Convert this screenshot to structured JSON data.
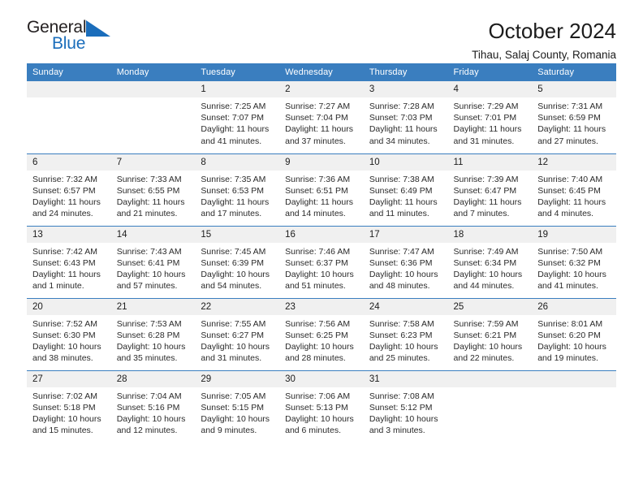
{
  "brand": {
    "name_part1": "General",
    "name_part2": "Blue",
    "accent_color": "#1a6dbb"
  },
  "header": {
    "title": "October 2024",
    "subtitle": "Tihau, Salaj County, Romania"
  },
  "calendar": {
    "header_bg": "#3a7ebf",
    "daynum_bg": "#f0f0f0",
    "weekday_headers": [
      "Sunday",
      "Monday",
      "Tuesday",
      "Wednesday",
      "Thursday",
      "Friday",
      "Saturday"
    ],
    "labels": {
      "sunrise": "Sunrise:",
      "sunset": "Sunset:",
      "daylight": "Daylight:"
    },
    "weeks": [
      [
        {
          "day": "",
          "empty": true
        },
        {
          "day": "",
          "empty": true
        },
        {
          "day": "1",
          "sunrise": "Sunrise: 7:25 AM",
          "sunset": "Sunset: 7:07 PM",
          "daylight_1": "Daylight: 11 hours",
          "daylight_2": "and 41 minutes."
        },
        {
          "day": "2",
          "sunrise": "Sunrise: 7:27 AM",
          "sunset": "Sunset: 7:04 PM",
          "daylight_1": "Daylight: 11 hours",
          "daylight_2": "and 37 minutes."
        },
        {
          "day": "3",
          "sunrise": "Sunrise: 7:28 AM",
          "sunset": "Sunset: 7:03 PM",
          "daylight_1": "Daylight: 11 hours",
          "daylight_2": "and 34 minutes."
        },
        {
          "day": "4",
          "sunrise": "Sunrise: 7:29 AM",
          "sunset": "Sunset: 7:01 PM",
          "daylight_1": "Daylight: 11 hours",
          "daylight_2": "and 31 minutes."
        },
        {
          "day": "5",
          "sunrise": "Sunrise: 7:31 AM",
          "sunset": "Sunset: 6:59 PM",
          "daylight_1": "Daylight: 11 hours",
          "daylight_2": "and 27 minutes."
        }
      ],
      [
        {
          "day": "6",
          "sunrise": "Sunrise: 7:32 AM",
          "sunset": "Sunset: 6:57 PM",
          "daylight_1": "Daylight: 11 hours",
          "daylight_2": "and 24 minutes."
        },
        {
          "day": "7",
          "sunrise": "Sunrise: 7:33 AM",
          "sunset": "Sunset: 6:55 PM",
          "daylight_1": "Daylight: 11 hours",
          "daylight_2": "and 21 minutes."
        },
        {
          "day": "8",
          "sunrise": "Sunrise: 7:35 AM",
          "sunset": "Sunset: 6:53 PM",
          "daylight_1": "Daylight: 11 hours",
          "daylight_2": "and 17 minutes."
        },
        {
          "day": "9",
          "sunrise": "Sunrise: 7:36 AM",
          "sunset": "Sunset: 6:51 PM",
          "daylight_1": "Daylight: 11 hours",
          "daylight_2": "and 14 minutes."
        },
        {
          "day": "10",
          "sunrise": "Sunrise: 7:38 AM",
          "sunset": "Sunset: 6:49 PM",
          "daylight_1": "Daylight: 11 hours",
          "daylight_2": "and 11 minutes."
        },
        {
          "day": "11",
          "sunrise": "Sunrise: 7:39 AM",
          "sunset": "Sunset: 6:47 PM",
          "daylight_1": "Daylight: 11 hours",
          "daylight_2": "and 7 minutes."
        },
        {
          "day": "12",
          "sunrise": "Sunrise: 7:40 AM",
          "sunset": "Sunset: 6:45 PM",
          "daylight_1": "Daylight: 11 hours",
          "daylight_2": "and 4 minutes."
        }
      ],
      [
        {
          "day": "13",
          "sunrise": "Sunrise: 7:42 AM",
          "sunset": "Sunset: 6:43 PM",
          "daylight_1": "Daylight: 11 hours",
          "daylight_2": "and 1 minute."
        },
        {
          "day": "14",
          "sunrise": "Sunrise: 7:43 AM",
          "sunset": "Sunset: 6:41 PM",
          "daylight_1": "Daylight: 10 hours",
          "daylight_2": "and 57 minutes."
        },
        {
          "day": "15",
          "sunrise": "Sunrise: 7:45 AM",
          "sunset": "Sunset: 6:39 PM",
          "daylight_1": "Daylight: 10 hours",
          "daylight_2": "and 54 minutes."
        },
        {
          "day": "16",
          "sunrise": "Sunrise: 7:46 AM",
          "sunset": "Sunset: 6:37 PM",
          "daylight_1": "Daylight: 10 hours",
          "daylight_2": "and 51 minutes."
        },
        {
          "day": "17",
          "sunrise": "Sunrise: 7:47 AM",
          "sunset": "Sunset: 6:36 PM",
          "daylight_1": "Daylight: 10 hours",
          "daylight_2": "and 48 minutes."
        },
        {
          "day": "18",
          "sunrise": "Sunrise: 7:49 AM",
          "sunset": "Sunset: 6:34 PM",
          "daylight_1": "Daylight: 10 hours",
          "daylight_2": "and 44 minutes."
        },
        {
          "day": "19",
          "sunrise": "Sunrise: 7:50 AM",
          "sunset": "Sunset: 6:32 PM",
          "daylight_1": "Daylight: 10 hours",
          "daylight_2": "and 41 minutes."
        }
      ],
      [
        {
          "day": "20",
          "sunrise": "Sunrise: 7:52 AM",
          "sunset": "Sunset: 6:30 PM",
          "daylight_1": "Daylight: 10 hours",
          "daylight_2": "and 38 minutes."
        },
        {
          "day": "21",
          "sunrise": "Sunrise: 7:53 AM",
          "sunset": "Sunset: 6:28 PM",
          "daylight_1": "Daylight: 10 hours",
          "daylight_2": "and 35 minutes."
        },
        {
          "day": "22",
          "sunrise": "Sunrise: 7:55 AM",
          "sunset": "Sunset: 6:27 PM",
          "daylight_1": "Daylight: 10 hours",
          "daylight_2": "and 31 minutes."
        },
        {
          "day": "23",
          "sunrise": "Sunrise: 7:56 AM",
          "sunset": "Sunset: 6:25 PM",
          "daylight_1": "Daylight: 10 hours",
          "daylight_2": "and 28 minutes."
        },
        {
          "day": "24",
          "sunrise": "Sunrise: 7:58 AM",
          "sunset": "Sunset: 6:23 PM",
          "daylight_1": "Daylight: 10 hours",
          "daylight_2": "and 25 minutes."
        },
        {
          "day": "25",
          "sunrise": "Sunrise: 7:59 AM",
          "sunset": "Sunset: 6:21 PM",
          "daylight_1": "Daylight: 10 hours",
          "daylight_2": "and 22 minutes."
        },
        {
          "day": "26",
          "sunrise": "Sunrise: 8:01 AM",
          "sunset": "Sunset: 6:20 PM",
          "daylight_1": "Daylight: 10 hours",
          "daylight_2": "and 19 minutes."
        }
      ],
      [
        {
          "day": "27",
          "sunrise": "Sunrise: 7:02 AM",
          "sunset": "Sunset: 5:18 PM",
          "daylight_1": "Daylight: 10 hours",
          "daylight_2": "and 15 minutes."
        },
        {
          "day": "28",
          "sunrise": "Sunrise: 7:04 AM",
          "sunset": "Sunset: 5:16 PM",
          "daylight_1": "Daylight: 10 hours",
          "daylight_2": "and 12 minutes."
        },
        {
          "day": "29",
          "sunrise": "Sunrise: 7:05 AM",
          "sunset": "Sunset: 5:15 PM",
          "daylight_1": "Daylight: 10 hours",
          "daylight_2": "and 9 minutes."
        },
        {
          "day": "30",
          "sunrise": "Sunrise: 7:06 AM",
          "sunset": "Sunset: 5:13 PM",
          "daylight_1": "Daylight: 10 hours",
          "daylight_2": "and 6 minutes."
        },
        {
          "day": "31",
          "sunrise": "Sunrise: 7:08 AM",
          "sunset": "Sunset: 5:12 PM",
          "daylight_1": "Daylight: 10 hours",
          "daylight_2": "and 3 minutes."
        },
        {
          "day": "",
          "empty": true
        },
        {
          "day": "",
          "empty": true
        }
      ]
    ]
  }
}
